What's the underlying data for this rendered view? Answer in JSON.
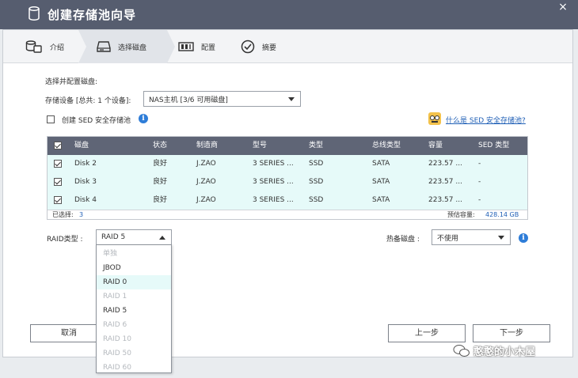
{
  "window": {
    "title": "创建存储池向导",
    "close_glyph": "×"
  },
  "steps": [
    {
      "label": "介绍",
      "icon": "storage-pool-icon"
    },
    {
      "label": "选择磁盘",
      "icon": "disk-drive-icon"
    },
    {
      "label": "配置",
      "icon": "raid-config-icon"
    },
    {
      "label": "摘要",
      "icon": "check-circle-icon"
    }
  ],
  "form": {
    "section_title": "选择并配置磁盘:",
    "device_label": "存储设备 [总共: 1 个设备]:",
    "device_value": "NAS主机 [3/6 可用磁盘]",
    "sed_checkbox_label": "创建 SED 安全存储池",
    "sed_link": "什么是 SED 安全存储池?"
  },
  "table": {
    "columns": [
      "磁盘",
      "状态",
      "制造商",
      "型号",
      "类型",
      "总线类型",
      "容量",
      "SED 类型"
    ],
    "rows": [
      {
        "checked": true,
        "disk": "Disk 2",
        "status": "良好",
        "vendor": "J.ZAO",
        "model": "3 SERIES ...",
        "type": "SSD",
        "bus": "SATA",
        "capacity": "223.57 ...",
        "sed": "-"
      },
      {
        "checked": true,
        "disk": "Disk 3",
        "status": "良好",
        "vendor": "J.ZAO",
        "model": "3 SERIES ...",
        "type": "SSD",
        "bus": "SATA",
        "capacity": "223.57 ...",
        "sed": "-"
      },
      {
        "checked": true,
        "disk": "Disk 4",
        "status": "良好",
        "vendor": "J.ZAO",
        "model": "3 SERIES ...",
        "type": "SSD",
        "bus": "SATA",
        "capacity": "223.57 ...",
        "sed": "-"
      }
    ],
    "selected_label": "已选择:",
    "selected_count": "3",
    "estimated_label": "预估容量:",
    "estimated_value": "428.14 GB"
  },
  "raid": {
    "label": "RAID类型 :",
    "value": "RAID 5",
    "options": [
      {
        "label": "单独",
        "disabled": true
      },
      {
        "label": "JBOD",
        "disabled": false
      },
      {
        "label": "RAID 0",
        "disabled": false,
        "highlighted": true
      },
      {
        "label": "RAID 1",
        "disabled": true
      },
      {
        "label": "RAID 5",
        "disabled": false
      },
      {
        "label": "RAID 6",
        "disabled": true
      },
      {
        "label": "RAID 10",
        "disabled": true
      },
      {
        "label": "RAID 50",
        "disabled": true
      },
      {
        "label": "RAID 60",
        "disabled": true
      }
    ]
  },
  "hotspare": {
    "label": "热备磁盘 :",
    "value": "不使用"
  },
  "buttons": {
    "cancel": "取消",
    "prev": "上一步",
    "next": "下一步"
  },
  "watermark": {
    "text": "憨憨的小木屋"
  },
  "colors": {
    "titlebar": "#565d6f",
    "table_header": "#5f6576",
    "row_bg": "#e6faf9",
    "link": "#1f5fb6",
    "info": "#2e7dd8"
  }
}
